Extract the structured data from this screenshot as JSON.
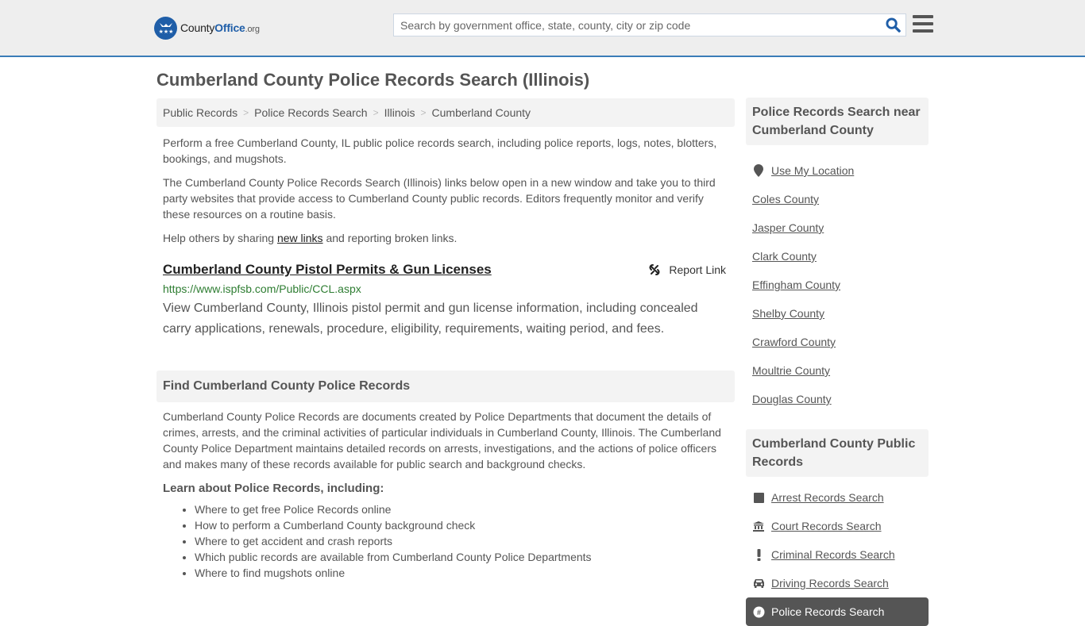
{
  "header": {
    "logo": {
      "name": "County",
      "accent": "Office",
      "suffix": ".org"
    },
    "search": {
      "placeholder": "Search by government office, state, county, city or zip code",
      "value": ""
    }
  },
  "page": {
    "title": "Cumberland County Police Records Search (Illinois)",
    "breadcrumb": [
      "Public Records",
      "Police Records Search",
      "Illinois",
      "Cumberland County"
    ]
  },
  "intro": {
    "p1": "Perform a free Cumberland County, IL public police records search, including police reports, logs, notes, blotters, bookings, and mugshots.",
    "p2": "The Cumberland County Police Records Search (Illinois) links below open in a new window and take you to third party websites that provide access to Cumberland County public records. Editors frequently monitor and verify these resources on a routine basis.",
    "p3_before": "Help others by sharing ",
    "p3_link": "new links",
    "p3_after": " and reporting broken links."
  },
  "result": {
    "title": "Cumberland County Pistol Permits & Gun Licenses",
    "report_label": "Report Link",
    "url": "https://www.ispfsb.com/Public/CCL.aspx",
    "description": "View Cumberland County, Illinois pistol permit and gun license information, including concealed carry applications, renewals, procedure, eligibility, requirements, waiting period, and fees."
  },
  "find": {
    "heading": "Find Cumberland County Police Records",
    "body": "Cumberland County Police Records are documents created by Police Departments that document the details of crimes, arrests, and the criminal activities of particular individuals in Cumberland County, Illinois. The Cumberland County Police Department maintains detailed records on arrests, investigations, and the actions of police officers and makes many of these records available for public search and background checks.",
    "learn_heading": "Learn about Police Records, including:",
    "learn_items": [
      "Where to get free Police Records online",
      "How to perform a Cumberland County background check",
      "Where to get accident and crash reports",
      "Which public records are available from Cumberland County Police Departments",
      "Where to find mugshots online"
    ]
  },
  "sidebar": {
    "nearby_heading": "Police Records Search near Cumberland County",
    "use_location": "Use My Location",
    "nearby": [
      "Coles County",
      "Jasper County",
      "Clark County",
      "Effingham County",
      "Shelby County",
      "Crawford County",
      "Moultrie County",
      "Douglas County"
    ],
    "public_heading": "Cumberland County Public Records",
    "public_items": [
      {
        "label": "Arrest Records Search",
        "icon": "square-icon"
      },
      {
        "label": "Court Records Search",
        "icon": "courthouse-icon"
      },
      {
        "label": "Criminal Records Search",
        "icon": "exclamation-icon"
      },
      {
        "label": "Driving Records Search",
        "icon": "car-icon"
      },
      {
        "label": "Police Records Search",
        "icon": "badge-icon",
        "active": true
      }
    ]
  },
  "colors": {
    "brand": "#1f5ea8",
    "header_border": "#3a7cb8",
    "url_green": "#2e7d32",
    "active_bg": "#555555"
  }
}
